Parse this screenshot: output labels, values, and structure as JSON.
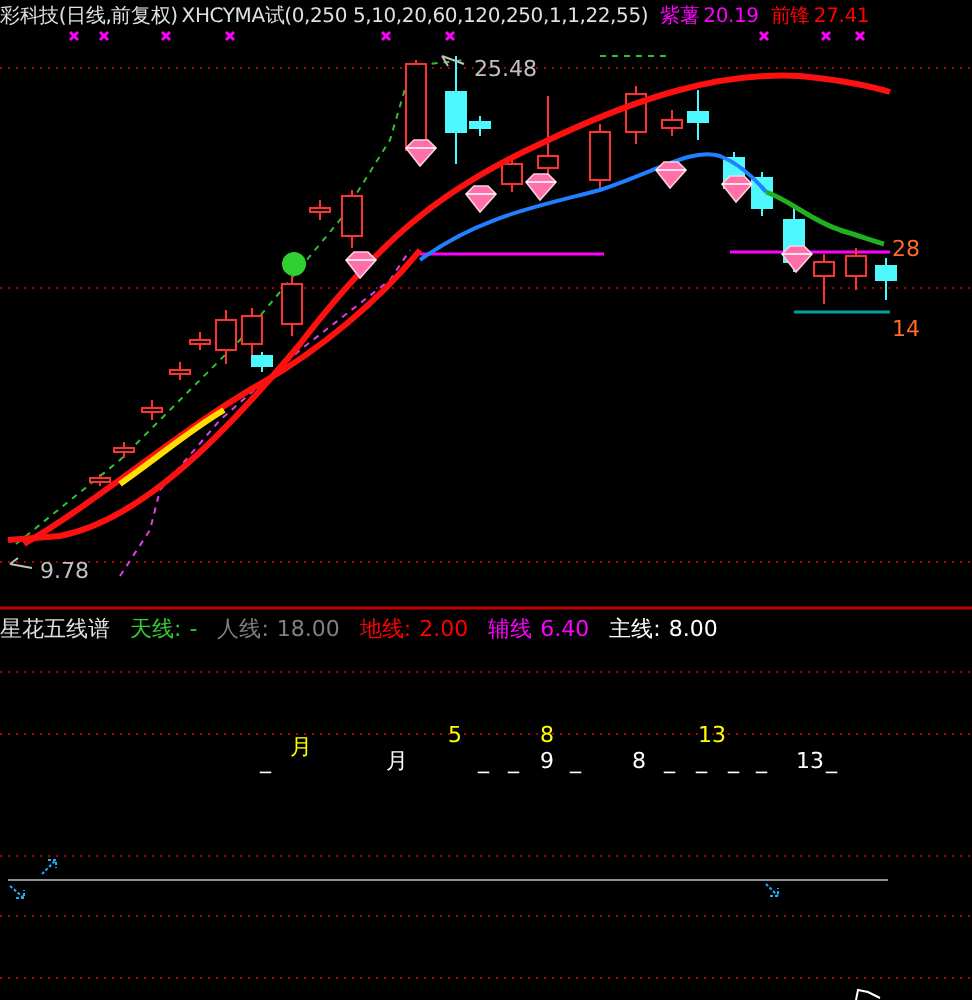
{
  "header": {
    "title": "彩科技(日线,前复权)",
    "indicator": "XHCYMA试(0,250 5,10,20,60,120,250,1,1,22,55)",
    "values": [
      {
        "label": "紫薯",
        "value": "20.19",
        "color": "#ff00ff"
      },
      {
        "label": "前锋",
        "value": "27.41",
        "color": "#ff0000"
      }
    ]
  },
  "price_labels": [
    {
      "text": "25.48",
      "color": "#c0c0c0"
    },
    {
      "text": "28",
      "color": "#ff6a2a"
    },
    {
      "text": "14",
      "color": "#ff6a2a"
    },
    {
      "text": "9.78",
      "color": "#c0c0c0"
    }
  ],
  "sub_panel": {
    "title": "星花五线谱",
    "lines": [
      {
        "label": "天线:",
        "value": "-",
        "color": "#33cc33"
      },
      {
        "label": "人线:",
        "value": "18.00",
        "color": "#808080"
      },
      {
        "label": "地线:",
        "value": "2.00",
        "color": "#ff0000"
      },
      {
        "label": "辅线",
        "value": "6.40",
        "color": "#ff00ff"
      },
      {
        "label": "主线:",
        "value": "8.00",
        "color": "#ffffff"
      }
    ]
  },
  "marks": [
    {
      "text": "_",
      "color": "#ffffff"
    },
    {
      "text": "月",
      "color": "#ffff00"
    },
    {
      "text": "月",
      "color": "#ffffff"
    },
    {
      "text": "5",
      "color": "#ffff00"
    },
    {
      "text": "_",
      "color": "#ffffff"
    },
    {
      "text": "_",
      "color": "#ffffff"
    },
    {
      "text": "8",
      "color": "#ffff00"
    },
    {
      "text": "9",
      "color": "#ffffff"
    },
    {
      "text": "_",
      "color": "#ffffff"
    },
    {
      "text": "8",
      "color": "#ffffff"
    },
    {
      "text": "_",
      "color": "#ffffff"
    },
    {
      "text": "_",
      "color": "#ffffff"
    },
    {
      "text": "13",
      "color": "#ffff00"
    },
    {
      "text": "_",
      "color": "#ffffff"
    },
    {
      "text": "_",
      "color": "#ffffff"
    },
    {
      "text": "13",
      "color": "#ffffff"
    },
    {
      "text": "_",
      "color": "#ffffff"
    }
  ]
}
